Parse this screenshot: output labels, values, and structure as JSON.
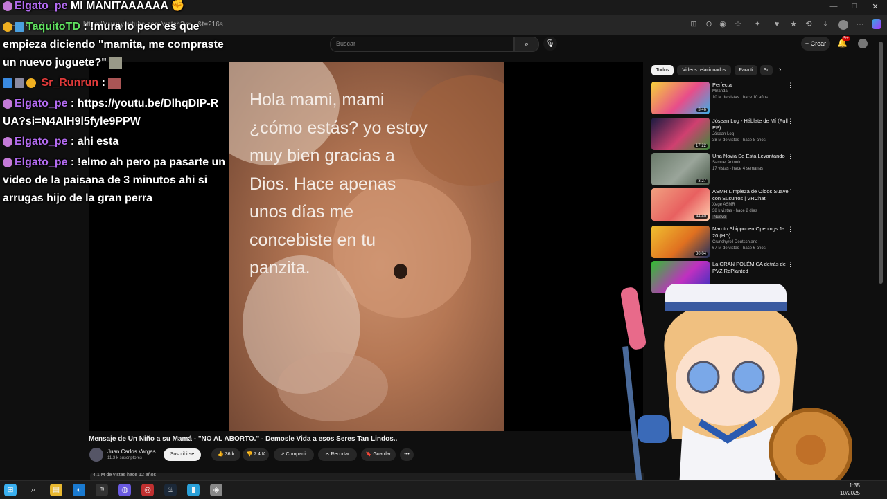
{
  "window": {
    "tab_title": "",
    "url": "https://www.youtube.com/watch?v=...&t=216s",
    "controls": {
      "minimize": "—",
      "maximize": "□",
      "close": "✕"
    }
  },
  "header": {
    "search_placeholder": "Buscar",
    "search_icon": "search-icon",
    "mic_icon": "mic-icon",
    "create_label": "+ Crear",
    "notifications_badge": "9+"
  },
  "video": {
    "caption_lines": [
      "Hola mami, mami",
      "¿cómo estás? yo estoy",
      "muy bien gracias a",
      "Dios. Hace apenas",
      "unos días me",
      "concebiste en tu",
      "panzita."
    ],
    "title": "Mensaje de Un Niño a su Mamá - \"NO AL ABORTO.\" - Demosle Vida a esos Seres Tan Lindos..",
    "channel_name": "Juan Carlos Vargas",
    "channel_subs": "11.3 k suscriptores",
    "subscribe_label": "Suscribirse",
    "likes": "36 k",
    "dislikes": "7.4 K",
    "share_label": "Compartir",
    "clip_label": "Recortar",
    "save_label": "Guardar",
    "more_label": "•••",
    "views_info": "4.1 M de vistas  hace 12 años"
  },
  "sidebar": {
    "chips": [
      "Todos",
      "Videos relacionados",
      "Para ti",
      "Su"
    ],
    "chip_next_icon": "chevron-right-icon",
    "recommendations": [
      {
        "title": "Perfecta",
        "channel": "Miranda!",
        "meta": "10 M de vistas · hace 10 años",
        "duration": "3:46",
        "colors": [
          "#f6d23a",
          "#e84d8a",
          "#3ab0e8"
        ]
      },
      {
        "title": "Jósean Log - Háblate de Mí (Full EP)",
        "channel": "Jósean Log",
        "meta": "38 M de vistas · hace 8 años",
        "duration": "17:22",
        "colors": [
          "#1a1a40",
          "#d04070",
          "#3a8a3a"
        ]
      },
      {
        "title": "Una Novia Se Esta Levantando",
        "channel": "Samuel Antonio",
        "meta": "17 vistas · hace 4 semanas",
        "duration": "3:27",
        "colors": [
          "#6a7a6a",
          "#9aa59a",
          "#4a5a4a"
        ]
      },
      {
        "title": "ASMR Limpieza de Oídos Suave con Susurros | VRChat",
        "channel": "Xege ASMR",
        "meta": "38 k vistas · hace 2 días",
        "badge": "Nuevo",
        "duration": "44:40",
        "colors": [
          "#f0a080",
          "#e86060",
          "#ffd0b0"
        ]
      },
      {
        "title": "Naruto Shippuden Openings 1-20 (HD)",
        "channel": "Crunchyroll Deutschland",
        "meta": "67 M de vistas · hace 6 años",
        "duration": "30:04",
        "colors": [
          "#f0c030",
          "#e07020",
          "#203060"
        ]
      },
      {
        "title": "La GRAN POLÉMICA detrás de PVZ RePlanted",
        "channel": "",
        "meta": "",
        "duration": "",
        "colors": [
          "#30c030",
          "#c030c0",
          "#3030c0"
        ]
      }
    ]
  },
  "chat": [
    {
      "user": "Elgato_pe",
      "color": "purple",
      "text": " MI MANITAAAAAA"
    },
    {
      "user": "TaquitoTD",
      "color": "green",
      "text": " : !mura lo peor es que empieza diciendo \"mamita, me compraste un nuevo juguete?\""
    },
    {
      "user": "Sr_Runrun",
      "color": "red",
      "text": " :"
    },
    {
      "user": "Elgato_pe",
      "color": "purple",
      "text": " : https://youtu.be/DlhqDIP-RUA?si=N4AlH9l5fyle9PPW"
    },
    {
      "user": "Elgato_pe",
      "color": "purple",
      "text": " : ahi esta"
    },
    {
      "user": "Elgato_pe",
      "color": "purple",
      "text": " : !elmo ah pero pa pasarte un video de la paisana de 3 minutos ahi si arrugas hijo de la gran perra"
    }
  ],
  "taskbar": {
    "apps": [
      "windows-start-icon",
      "search-icon",
      "file-explorer-icon",
      "edge-browser-icon",
      "app-icon",
      "discord-icon",
      "obs-icon",
      "steam-icon",
      "app-icon",
      "app-icon"
    ],
    "time": "1:35",
    "date": "10/2025"
  }
}
